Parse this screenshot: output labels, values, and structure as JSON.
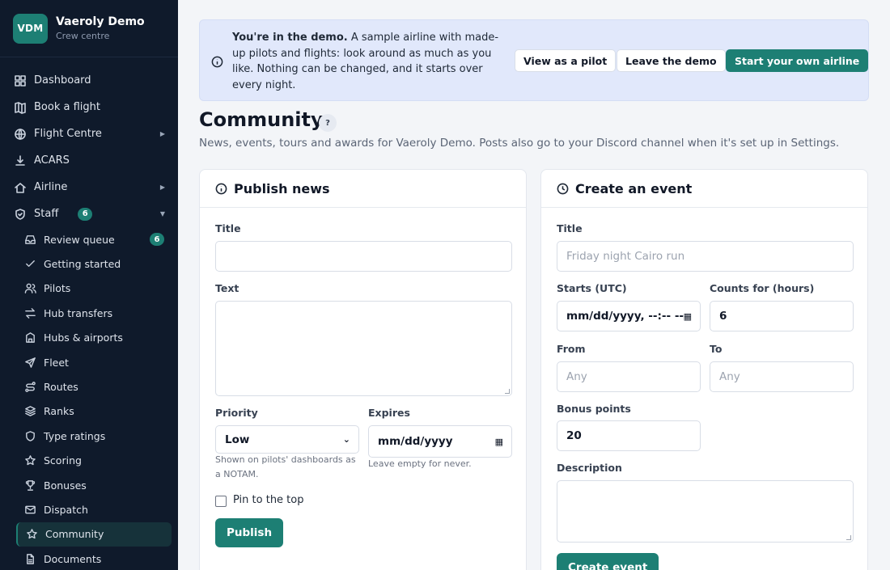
{
  "brand": {
    "logo": "VDM",
    "name": "Vaeroly Demo",
    "subtitle": "Crew centre"
  },
  "nav": [
    {
      "label": "Dashboard",
      "icon": "dashboard-icon"
    },
    {
      "label": "Book a flight",
      "icon": "map-icon"
    },
    {
      "label": "Flight Centre",
      "icon": "globe-icon",
      "caret": "▶"
    },
    {
      "label": "ACARS",
      "icon": "download-icon"
    },
    {
      "label": "Airline",
      "icon": "home-icon",
      "caret": "▶"
    },
    {
      "label": "Staff",
      "icon": "shield-icon",
      "caret": "▼",
      "badge": "6"
    }
  ],
  "staff_items": [
    {
      "label": "Review queue",
      "icon": "inbox-icon",
      "badge": "6"
    },
    {
      "label": "Getting started",
      "icon": "check-icon"
    },
    {
      "label": "Pilots",
      "icon": "users-icon"
    },
    {
      "label": "Hub transfers",
      "icon": "transfer-icon"
    },
    {
      "label": "Hubs & airports",
      "icon": "building-icon"
    },
    {
      "label": "Fleet",
      "icon": "plane-icon"
    },
    {
      "label": "Routes",
      "icon": "route-icon"
    },
    {
      "label": "Ranks",
      "icon": "layers-icon"
    },
    {
      "label": "Type ratings",
      "icon": "badge-icon"
    },
    {
      "label": "Scoring",
      "icon": "star-icon"
    },
    {
      "label": "Bonuses",
      "icon": "trophy-icon"
    },
    {
      "label": "Dispatch",
      "icon": "mail-icon"
    },
    {
      "label": "Community",
      "icon": "star-icon",
      "active": true
    },
    {
      "label": "Documents",
      "icon": "document-icon"
    }
  ],
  "banner": {
    "bold": "You're in the demo.",
    "text": " A sample airline with made-up pilots and flights: look around as much as you like. Nothing can be changed, and it starts over every night.",
    "buttons": {
      "view_pilot": "View as a pilot",
      "leave": "Leave the demo",
      "start": "Start your own airline"
    }
  },
  "page": {
    "title": "Community",
    "help": "?",
    "subtitle": "News, events, tours and awards for Vaeroly Demo. Posts also go to your Discord channel when it's set up in Settings."
  },
  "news": {
    "title": "Publish news",
    "title_label": "Title",
    "title_value": "",
    "text_label": "Text",
    "text_value": "",
    "priority_label": "Priority",
    "priority_value": "Low",
    "priority_help": "Shown on pilots' dashboards as a NOTAM.",
    "expires_label": "Expires",
    "expires_placeholder": "mm/dd/yyyy",
    "expires_help": "Leave empty for never.",
    "pin_label": "Pin to the top",
    "publish": "Publish"
  },
  "event": {
    "title": "Create an event",
    "title_label": "Title",
    "title_placeholder": "Friday night Cairo run",
    "starts_label": "Starts (UTC)",
    "starts_placeholder": "mm/dd/yyyy, --:-- --",
    "counts_label": "Counts for (hours)",
    "counts_value": "6",
    "from_label": "From",
    "from_placeholder": "Any",
    "to_label": "To",
    "to_placeholder": "Any",
    "bonus_label": "Bonus points",
    "bonus_value": "20",
    "desc_label": "Description",
    "create": "Create event"
  }
}
